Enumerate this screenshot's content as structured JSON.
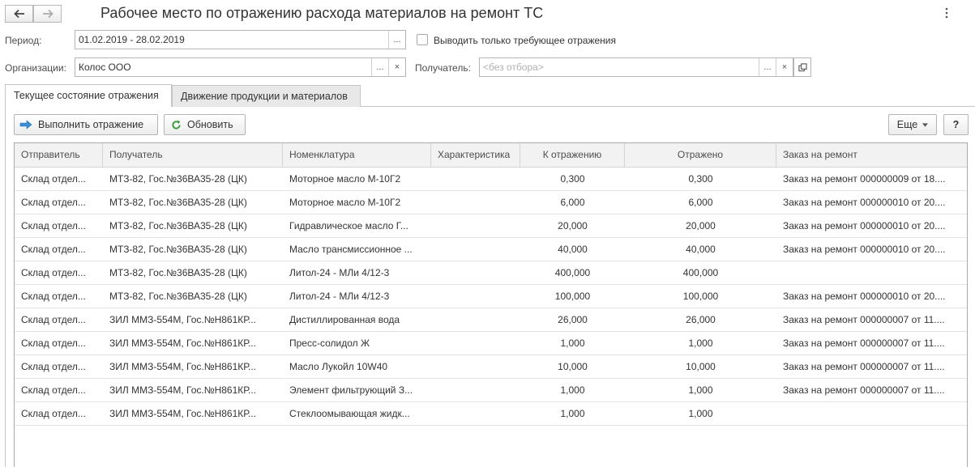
{
  "header": {
    "title": "Рабочее место по отражению расхода материалов на ремонт ТС"
  },
  "form": {
    "period_label": "Период:",
    "period_value": "01.02.2019 - 28.02.2019",
    "only_required_label": "Выводить только требующее отражения",
    "only_required_checked": false,
    "org_label": "Организации:",
    "org_value": "Колос ООО",
    "recipient_label": "Получатель:",
    "recipient_placeholder": "<без отбора>",
    "select_button": "...",
    "clear_button": "×"
  },
  "tabs": [
    {
      "label": "Текущее состояние отражения",
      "active": true
    },
    {
      "label": "Движение продукции и материалов",
      "active": false
    }
  ],
  "toolbar": {
    "execute_label": "Выполнить отражение",
    "refresh_label": "Обновить",
    "more_label": "Еще",
    "help_label": "?"
  },
  "table": {
    "columns": [
      "Отправитель",
      "Получатель",
      "Номенклатура",
      "Характеристика",
      "К отражению",
      "Отражено",
      "Заказ на ремонт"
    ],
    "rows": [
      [
        "Склад отдел...",
        "МТЗ-82, Гос.№36ВА35-28 (ЦК)",
        "Моторное масло М-10Г2",
        "",
        "0,300",
        "0,300",
        "Заказ на ремонт 000000009 от 18...."
      ],
      [
        "Склад отдел...",
        "МТЗ-82, Гос.№36ВА35-28 (ЦК)",
        "Моторное масло М-10Г2",
        "",
        "6,000",
        "6,000",
        "Заказ на ремонт 000000010 от 20...."
      ],
      [
        "Склад отдел...",
        "МТЗ-82, Гос.№36ВА35-28 (ЦК)",
        "Гидравлическое масло Г...",
        "",
        "20,000",
        "20,000",
        "Заказ на ремонт 000000010 от 20...."
      ],
      [
        "Склад отдел...",
        "МТЗ-82, Гос.№36ВА35-28 (ЦК)",
        "Масло трансмиссионное ...",
        "",
        "40,000",
        "40,000",
        "Заказ на ремонт 000000010 от 20...."
      ],
      [
        "Склад отдел...",
        "МТЗ-82, Гос.№36ВА35-28 (ЦК)",
        "Литол-24 - МЛи 4/12-3",
        "",
        "400,000",
        "400,000",
        ""
      ],
      [
        "Склад отдел...",
        "МТЗ-82, Гос.№36ВА35-28 (ЦК)",
        "Литол-24 - МЛи 4/12-3",
        "",
        "100,000",
        "100,000",
        "Заказ на ремонт 000000010 от 20...."
      ],
      [
        "Склад отдел...",
        "ЗИЛ ММЗ-554М, Гос.№Н861КР...",
        "Дистиллированная вода",
        "",
        "26,000",
        "26,000",
        "Заказ на ремонт 000000007 от 11...."
      ],
      [
        "Склад отдел...",
        "ЗИЛ ММЗ-554М, Гос.№Н861КР...",
        "Пресс-солидол Ж",
        "",
        "1,000",
        "1,000",
        "Заказ на ремонт 000000007 от 11...."
      ],
      [
        "Склад отдел...",
        "ЗИЛ ММЗ-554М, Гос.№Н861КР...",
        "Масло Лукойл 10W40",
        "",
        "10,000",
        "10,000",
        "Заказ на ремонт 000000007 от 11...."
      ],
      [
        "Склад отдел...",
        "ЗИЛ ММЗ-554М, Гос.№Н861КР...",
        "Элемент фильтрующий З...",
        "",
        "1,000",
        "1,000",
        "Заказ на ремонт 000000007 от 11...."
      ],
      [
        "Склад отдел...",
        "ЗИЛ ММЗ-554М, Гос.№Н861КР...",
        "Стеклоомывающая жидк...",
        "",
        "1,000",
        "1,000",
        ""
      ]
    ]
  },
  "colors": {
    "accent_arrow": "#3c8fd6",
    "refresh_green": "#3a9a3a",
    "border": "#b5b5b5"
  }
}
